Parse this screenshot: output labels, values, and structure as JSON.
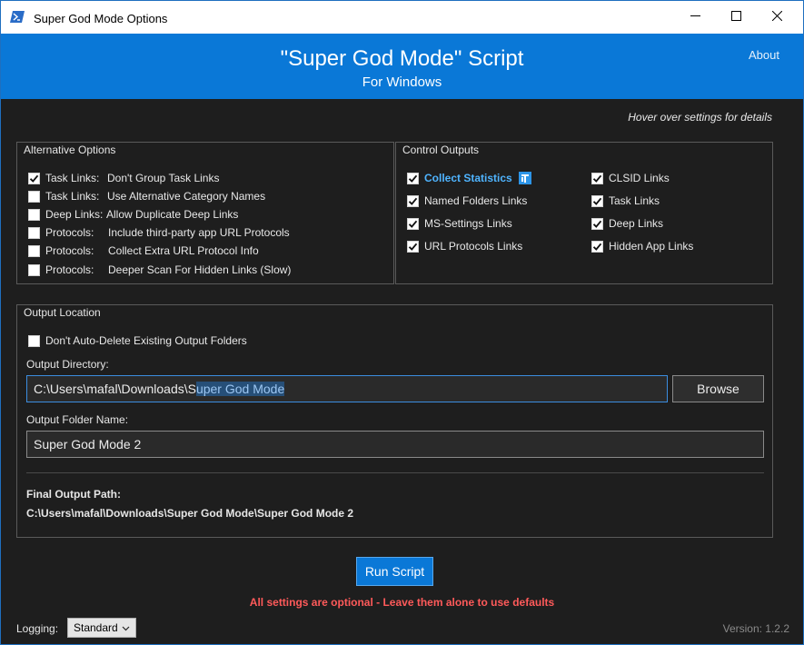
{
  "window": {
    "title": "Super God Mode Options"
  },
  "header": {
    "title": "\"Super God Mode\" Script",
    "subtitle": "For Windows",
    "about_label": "About"
  },
  "hint": "Hover over settings for details",
  "alternative_options": {
    "title": "Alternative Options",
    "items": [
      {
        "category": "Task Links:",
        "label": "Don't Group Task Links",
        "checked": true
      },
      {
        "category": "Task Links:",
        "label": "Use Alternative Category Names",
        "checked": false
      },
      {
        "category": "Deep Links:",
        "label": "Allow Duplicate Deep Links",
        "checked": false
      },
      {
        "category": "Protocols:",
        "label": "Include third-party app URL Protocols",
        "checked": false
      },
      {
        "category": "Protocols:",
        "label": "Collect Extra URL Protocol Info",
        "checked": false
      },
      {
        "category": "Protocols:",
        "label": "Deeper Scan For Hidden Links (Slow)",
        "checked": false
      }
    ]
  },
  "control_outputs": {
    "title": "Control Outputs",
    "left": [
      {
        "label": "Collect Statistics",
        "checked": true
      },
      {
        "label": "Named Folders Links",
        "checked": true
      },
      {
        "label": "MS-Settings Links",
        "checked": true
      },
      {
        "label": "URL Protocols Links",
        "checked": true
      }
    ],
    "right": [
      {
        "label": "CLSID Links",
        "checked": true
      },
      {
        "label": "Task Links",
        "checked": true
      },
      {
        "label": "Deep Links",
        "checked": true
      },
      {
        "label": "Hidden App Links",
        "checked": true
      }
    ]
  },
  "output_location": {
    "title": "Output Location",
    "no_autodelete_label": "Don't Auto-Delete Existing Output Folders",
    "no_autodelete_checked": false,
    "directory_label": "Output Directory:",
    "directory_prefix": "C:\\Users\\mafal\\Downloads\\S",
    "directory_selected": "uper God Mode",
    "browse_label": "Browse",
    "folder_name_label": "Output Folder Name:",
    "folder_name_value": "Super God Mode 2",
    "final_path_label": "Final Output Path:",
    "final_path_value": "C:\\Users\\mafal\\Downloads\\Super God Mode\\Super God Mode 2"
  },
  "run_label": "Run Script",
  "optional_note": "All settings are optional - Leave them alone to use defaults",
  "logging": {
    "label": "Logging:",
    "selected": "Standard"
  },
  "version": "Version: 1.2.2",
  "colors": {
    "accent": "#0a78d7",
    "background": "#1e1e1e",
    "warning": "#ff5a5a",
    "highlight": "#4fb4ff"
  }
}
